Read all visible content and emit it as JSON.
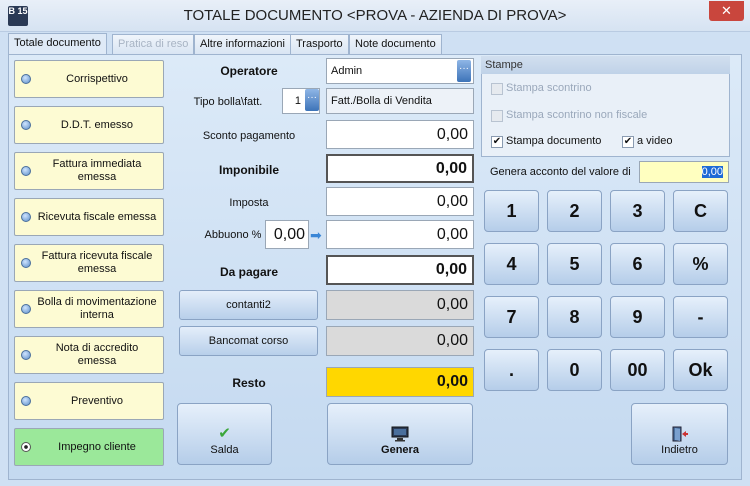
{
  "window": {
    "title": "TOTALE DOCUMENTO <PROVA - AZIENDA DI PROVA>",
    "app_icon_text": "B 15",
    "close_label": "✕"
  },
  "tabs": [
    {
      "label": "Totale documento"
    },
    {
      "label": "Pratica di reso"
    },
    {
      "label": "Altre informazioni"
    },
    {
      "label": "Trasporto"
    },
    {
      "label": "Note documento"
    }
  ],
  "doc_types": [
    {
      "label": "Corrispettivo"
    },
    {
      "label": "D.D.T. emesso"
    },
    {
      "label": "Fattura immediata emessa"
    },
    {
      "label": "Ricevuta fiscale emessa"
    },
    {
      "label": "Fattura ricevuta fiscale emessa"
    },
    {
      "label": "Bolla di movimentazione interna"
    },
    {
      "label": "Nota di accredito emessa"
    },
    {
      "label": "Preventivo"
    },
    {
      "label": "Impegno cliente"
    }
  ],
  "selected_doc_type": "Impegno cliente",
  "form": {
    "operatore_label": "Operatore",
    "operatore_value": "Admin",
    "tipo_bolla_label": "Tipo bolla\\fatt.",
    "tipo_bolla_num": "1",
    "tipo_bolla_desc": "Fatt./Bolla di Vendita",
    "sconto_label": "Sconto pagamento",
    "sconto_value": "0,00",
    "imponibile_label": "Imponibile",
    "imponibile_value": "0,00",
    "imposta_label": "Imposta",
    "imposta_value": "0,00",
    "abbuono_label": "Abbuono %",
    "abbuono_pct": "0,00",
    "abbuono_value": "0,00",
    "da_pagare_label": "Da pagare",
    "da_pagare_value": "0,00",
    "contanti_label": "contanti2",
    "contanti_value": "0,00",
    "bancomat_label": "Bancomat corso",
    "bancomat_value": "0,00",
    "resto_label": "Resto",
    "resto_value": "0,00"
  },
  "stampe": {
    "title": "Stampe",
    "scontrino": "Stampa scontrino",
    "scontrino_non_fiscale": "Stampa scontrino non fiscale",
    "documento": "Stampa documento",
    "a_video": "a video"
  },
  "acconto": {
    "label": "Genera acconto del valore di",
    "value": "0,00"
  },
  "keypad": [
    "1",
    "2",
    "3",
    "C",
    "4",
    "5",
    "6",
    "%",
    "7",
    "8",
    "9",
    "-",
    ".",
    "0",
    "00",
    "Ok"
  ],
  "actions": {
    "salda": "Salda",
    "genera": "Genera",
    "indietro": "Indietro"
  },
  "colors": {
    "selected_doc": "#9be89a",
    "doc_button": "#fdfbd3",
    "resto": "#ffd700",
    "acconto_field": "#ffffc0"
  }
}
